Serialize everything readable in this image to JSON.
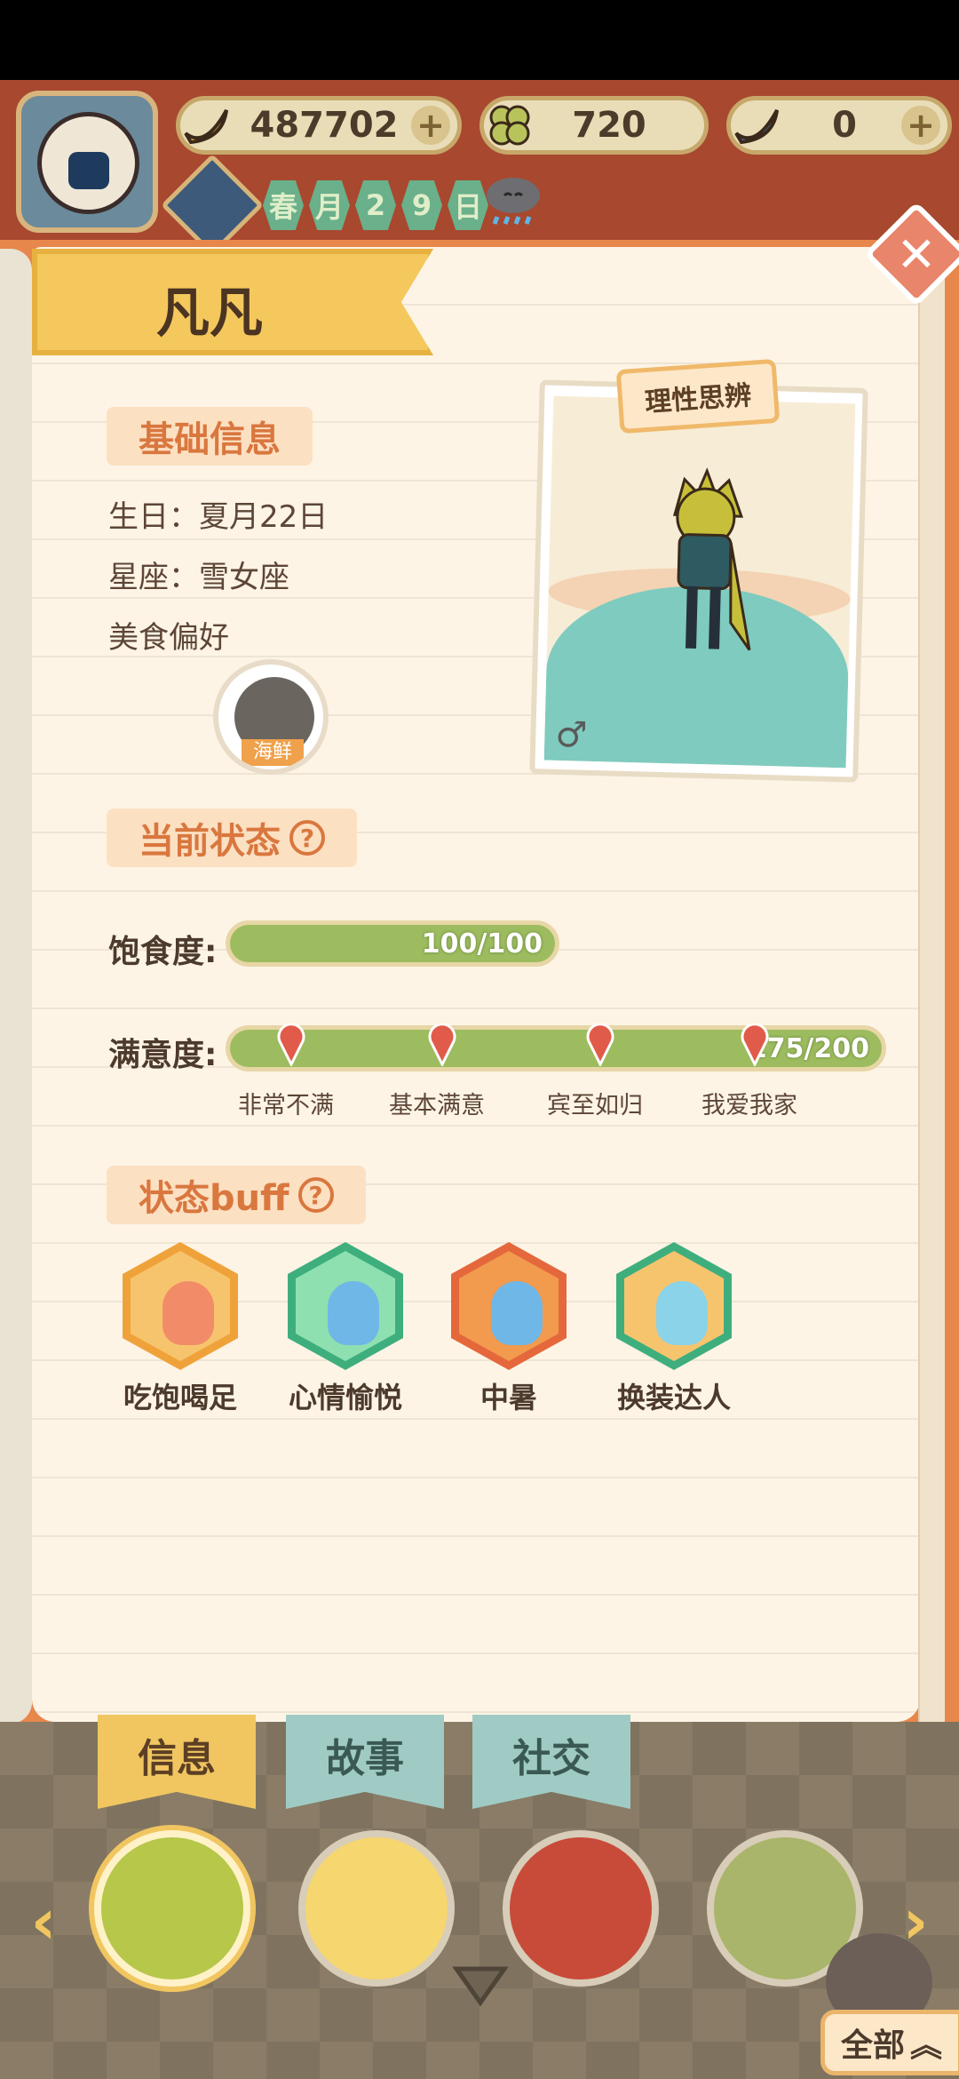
{
  "header": {
    "currencies": [
      {
        "icon": "banana-icon",
        "value": "487702",
        "has_plus": true
      },
      {
        "icon": "clover-icon",
        "value": "720",
        "has_plus": false
      },
      {
        "icon": "blue-banana-icon",
        "value": "0",
        "has_plus": true
      }
    ],
    "date": [
      "春",
      "月",
      "2",
      "9",
      "日"
    ],
    "weather_icon": "rain-cloud-icon"
  },
  "profile": {
    "name": "凡凡",
    "trait": "理性思辨",
    "gender_symbol": "♂",
    "basic_section": "基础信息",
    "birthday": "生日：夏月22日",
    "constellation": "星座：雪女座",
    "food_pref_label": "美食偏好",
    "food_pref": "海鲜"
  },
  "status": {
    "section": "当前状态",
    "satiety_label": "饱食度:",
    "satiety_value": "100/100",
    "satiety_fraction": 1.0,
    "satisfaction_label": "满意度:",
    "satisfaction_value": "175/200",
    "satisfaction_fraction": 1.0,
    "milestones": [
      "非常不满",
      "基本满意",
      "宾至如归",
      "我爱我家"
    ]
  },
  "buffs": {
    "section": "状态buff",
    "items": [
      {
        "label": "吃饱喝足",
        "frame": "#f0a23a",
        "bg": "#f7c46e",
        "face": "#f28c68",
        "icon": "full-stomach-icon"
      },
      {
        "label": "心情愉悦",
        "frame": "#3fae7d",
        "bg": "#8ee0b0",
        "face": "#6fb7e6",
        "icon": "happy-mood-icon"
      },
      {
        "label": "中暑",
        "frame": "#e4683b",
        "bg": "#f29a4e",
        "face": "#6fb7e6",
        "icon": "heatstroke-icon"
      },
      {
        "label": "换装达人",
        "frame": "#3fae7d",
        "bg": "#f7c46e",
        "face": "#8ad3e8",
        "icon": "outfit-icon"
      }
    ]
  },
  "tabs": [
    "信息",
    "故事",
    "社交"
  ],
  "all_button": "全部",
  "colors": {
    "accent_orange": "#d9773f",
    "bar_green": "#9dbc5f",
    "banner_yellow": "#f4c85d",
    "header_red": "#a8482f"
  }
}
